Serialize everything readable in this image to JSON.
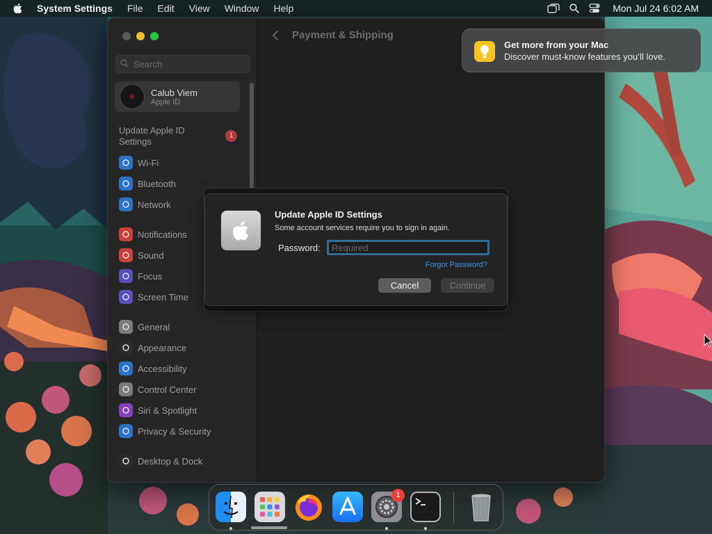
{
  "menubar": {
    "app_name": "System Settings",
    "menus": [
      "File",
      "Edit",
      "View",
      "Window",
      "Help"
    ],
    "clock": "Mon Jul 24  6:02 AM"
  },
  "window": {
    "title": "Payment & Shipping",
    "search_placeholder": "Search",
    "profile": {
      "name": "Calub Viem",
      "subtitle": "Apple ID"
    },
    "update_item": {
      "label": "Update Apple ID Settings",
      "badge": "1"
    },
    "sidebar": [
      {
        "label": "Wi-Fi",
        "icon": "wifi-icon",
        "color": "#2a73c9"
      },
      {
        "label": "Bluetooth",
        "icon": "bluetooth-icon",
        "color": "#2a73c9"
      },
      {
        "label": "Network",
        "icon": "globe-icon",
        "color": "#2a73c9"
      },
      {
        "label": "Notifications",
        "icon": "bell-icon",
        "color": "#c9413a"
      },
      {
        "label": "Sound",
        "icon": "speaker-icon",
        "color": "#c9413a"
      },
      {
        "label": "Focus",
        "icon": "moon-icon",
        "color": "#5a4fbf"
      },
      {
        "label": "Screen Time",
        "icon": "hourglass-icon",
        "color": "#5a4fbf"
      },
      {
        "label": "General",
        "icon": "gear-icon",
        "color": "#7a7a7a"
      },
      {
        "label": "Appearance",
        "icon": "appearance-icon",
        "color": "#2b2b2b"
      },
      {
        "label": "Accessibility",
        "icon": "accessibility-icon",
        "color": "#2a73c9"
      },
      {
        "label": "Control Center",
        "icon": "control-center-icon",
        "color": "#7a7a7a"
      },
      {
        "label": "Siri & Spotlight",
        "icon": "siri-icon",
        "color": "#8a3fbf"
      },
      {
        "label": "Privacy & Security",
        "icon": "hand-icon",
        "color": "#2a73c9"
      },
      {
        "label": "Desktop & Dock",
        "icon": "dock-icon",
        "color": "#2b2b2b"
      }
    ]
  },
  "notification": {
    "title": "Get more from your Mac",
    "body": "Discover must-know features you’ll love."
  },
  "dialog": {
    "title": "Update Apple ID Settings",
    "message": "Some account services require you to sign in again.",
    "password_label": "Password:",
    "password_placeholder": "Required",
    "forgot_link": "Forgot Password?",
    "cancel_label": "Cancel",
    "continue_label": "Continue"
  },
  "dock": {
    "apps": [
      "Finder",
      "Launchpad",
      "Firefox",
      "App Store",
      "System Settings",
      "Terminal",
      "Trash"
    ],
    "settings_badge": "1"
  }
}
